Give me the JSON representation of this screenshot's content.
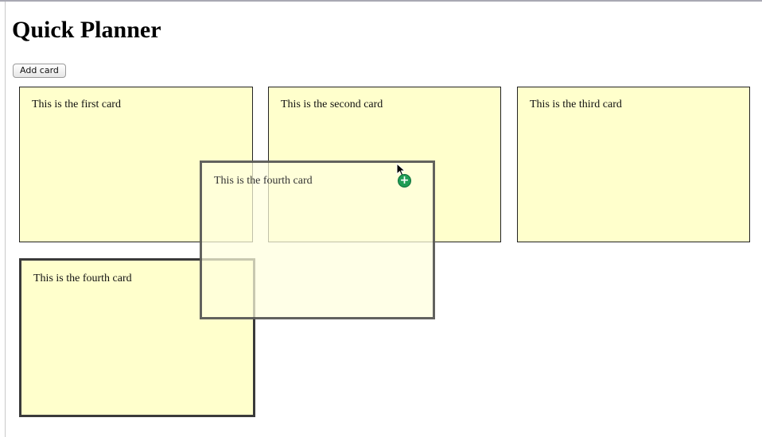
{
  "app": {
    "title": "Quick Planner"
  },
  "toolbar": {
    "add_card_label": "Add card"
  },
  "cards": [
    {
      "text": "This is the first card"
    },
    {
      "text": "This is the second card"
    },
    {
      "text": "This is the third card"
    },
    {
      "text": "This is the fourth card"
    }
  ],
  "drag_preview": {
    "text": "This is the fourth card"
  },
  "cursor": {
    "badge_glyph": "+"
  },
  "colors": {
    "card_background": "#ffffcc",
    "card_border": "#222222",
    "selected_card_border": "#3a3a3a",
    "copy_badge": "#1f9d55"
  }
}
